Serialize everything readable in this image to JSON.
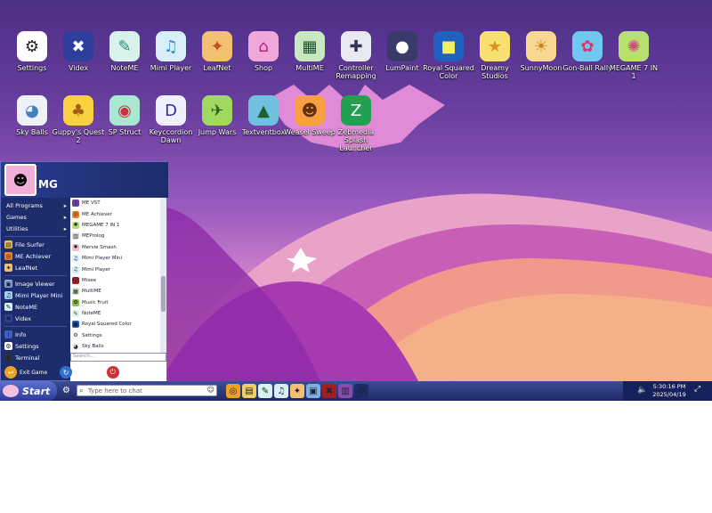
{
  "desktop_icons": [
    {
      "label": "Settings",
      "glyph": "⚙",
      "bg": "#ffffff",
      "fg": "#222222",
      "name": "settings"
    },
    {
      "label": "Videx",
      "glyph": "✖",
      "bg": "#2d3f9a",
      "fg": "#ffffff",
      "name": "videx"
    },
    {
      "label": "NoteME",
      "glyph": "✎",
      "bg": "#d9f2ec",
      "fg": "#2a8a70",
      "name": "noteme"
    },
    {
      "label": "Mimi Player",
      "glyph": "♫",
      "bg": "#d8eef8",
      "fg": "#3a8ac0",
      "name": "mimi-player"
    },
    {
      "label": "LeafNet",
      "glyph": "✦",
      "bg": "#f2c070",
      "fg": "#c05020",
      "name": "leafnet"
    },
    {
      "label": "Shop",
      "glyph": "⌂",
      "bg": "#f0a8d8",
      "fg": "#b02080",
      "name": "shop"
    },
    {
      "label": "MultiME",
      "glyph": "▦",
      "bg": "#c8e8c0",
      "fg": "#205030",
      "name": "multime"
    },
    {
      "label": "Controller Remapping",
      "glyph": "✚",
      "bg": "#e8e8f0",
      "fg": "#333355",
      "name": "controller-remapping"
    },
    {
      "label": "LumPaint",
      "glyph": "●",
      "bg": "#3a3a6a",
      "fg": "#ffffff",
      "name": "lumpaint"
    },
    {
      "label": "Royal Squared Color",
      "glyph": "■",
      "bg": "#2060c0",
      "fg": "#f0f060",
      "name": "royal-squared-color"
    },
    {
      "label": "Dreamy Studios",
      "glyph": "★",
      "bg": "#f8e070",
      "fg": "#e09020",
      "name": "dreamy-studios"
    },
    {
      "label": "SunnyMoon",
      "glyph": "☀",
      "bg": "#f8d890",
      "fg": "#d08020",
      "name": "sunnymoon"
    },
    {
      "label": "Gon-Ball Rally",
      "glyph": "✿",
      "bg": "#70c8f0",
      "fg": "#e03070",
      "name": "gon-ball-rally"
    },
    {
      "label": "MEGAME 7 IN 1",
      "glyph": "✺",
      "bg": "#b8e070",
      "fg": "#e04090",
      "name": "megame-7-in-1"
    },
    {
      "label": "Sky Balls",
      "glyph": "◕",
      "bg": "#f0f0f8",
      "fg": "#4080c0",
      "name": "sky-balls"
    },
    {
      "label": "Guppy's Quest 2",
      "glyph": "♣",
      "bg": "#f8d040",
      "fg": "#a06010",
      "name": "guppys-quest-2"
    },
    {
      "label": "SP Struct",
      "glyph": "◉",
      "bg": "#a8e8d0",
      "fg": "#d03040",
      "name": "sp-struct"
    },
    {
      "label": "Keyccordion Dawn",
      "glyph": "D",
      "bg": "#f0f0ff",
      "fg": "#3030a0",
      "name": "keyccordion-dawn"
    },
    {
      "label": "Jump Wars",
      "glyph": "✈",
      "bg": "#a0d860",
      "fg": "#306020",
      "name": "jump-wars"
    },
    {
      "label": "Textventbox",
      "glyph": "▲",
      "bg": "#70c0e0",
      "fg": "#206030",
      "name": "textventbox"
    },
    {
      "label": "Weasel Sweep",
      "glyph": "☻",
      "bg": "#f8a040",
      "fg": "#603010",
      "name": "weasel-sweep"
    },
    {
      "label": "Zebmedia Splash Launcher",
      "glyph": "Z",
      "bg": "#20a050",
      "fg": "#ffffff",
      "name": "zebmedia-splash-launcher"
    }
  ],
  "start_menu": {
    "user": "MG",
    "categories": [
      {
        "label": "All Programs",
        "arrow": "▸"
      },
      {
        "label": "Games",
        "arrow": "▸"
      },
      {
        "label": "Utilities",
        "arrow": "▸"
      }
    ],
    "pinned_a": [
      {
        "label": "File Surfer",
        "glyph": "▤",
        "color": "#f0c040"
      },
      {
        "label": "ME Achiever",
        "glyph": "◎",
        "color": "#f08020"
      },
      {
        "label": "LeafNet",
        "glyph": "✦",
        "color": "#f2c070"
      }
    ],
    "pinned_b": [
      {
        "label": "Image Viewer",
        "glyph": "▣",
        "color": "#80b0e0"
      },
      {
        "label": "Mimi Player Mini",
        "glyph": "♫",
        "color": "#a0d0f0"
      },
      {
        "label": "NoteME",
        "glyph": "✎",
        "color": "#d9f2ec"
      },
      {
        "label": "Videx",
        "glyph": "✖",
        "color": "#2d3f9a"
      }
    ],
    "pinned_c": [
      {
        "label": "Info",
        "glyph": "i",
        "color": "#4060c0"
      },
      {
        "label": "Settings",
        "glyph": "⚙",
        "color": "#ffffff"
      },
      {
        "label": "Terminal",
        "glyph": "▮",
        "color": "#303030"
      }
    ],
    "programs": [
      {
        "label": "ME VST",
        "glyph": "♪",
        "color": "#6a40a0"
      },
      {
        "label": "ME Achiever",
        "glyph": "◎",
        "color": "#f08020"
      },
      {
        "label": "MEGAME 7 IN 1",
        "glyph": "✺",
        "color": "#b8e070"
      },
      {
        "label": "MEProlog",
        "glyph": "▥",
        "color": "#e0e0e0"
      },
      {
        "label": "Mervie Smash",
        "glyph": "✹",
        "color": "#f0c0c0"
      },
      {
        "label": "Mimi Player Mini",
        "glyph": "♫",
        "color": "#d8eef8"
      },
      {
        "label": "Mimi Player",
        "glyph": "♫",
        "color": "#d8eef8"
      },
      {
        "label": "Mixee",
        "glyph": "☺",
        "color": "#a02020"
      },
      {
        "label": "MultiME",
        "glyph": "▦",
        "color": "#c8e8c0"
      },
      {
        "label": "Music Fruit",
        "glyph": "✿",
        "color": "#90c040"
      },
      {
        "label": "NoteME",
        "glyph": "✎",
        "color": "#d9f2ec"
      },
      {
        "label": "Royal Squared Color",
        "glyph": "■",
        "color": "#2060c0"
      },
      {
        "label": "Settings",
        "glyph": "⚙",
        "color": "#ffffff"
      },
      {
        "label": "Sky Balls",
        "glyph": "◕",
        "color": "#f0f0f8"
      }
    ],
    "search_placeholder": "Search...",
    "footer": {
      "exit": "Exit Game",
      "restart": "Restart",
      "shutdown": "Shut Down"
    }
  },
  "taskbar": {
    "start_label": "Start",
    "chat_placeholder": "Type here to chat",
    "apps": [
      {
        "glyph": "◎",
        "color": "#f0a020",
        "name": "me-achiever"
      },
      {
        "glyph": "▤",
        "color": "#f0d060",
        "name": "file-surfer"
      },
      {
        "glyph": "✎",
        "color": "#d9f2ec",
        "name": "noteme"
      },
      {
        "glyph": "♫",
        "color": "#d8eef8",
        "name": "mimi-player"
      },
      {
        "glyph": "✦",
        "color": "#f2c070",
        "name": "leafnet"
      },
      {
        "glyph": "▣",
        "color": "#80b0e0",
        "name": "image-viewer"
      },
      {
        "glyph": "✖",
        "color": "#a02020",
        "name": "mixee"
      },
      {
        "glyph": "▥",
        "color": "#8a4ab0",
        "name": "wallpaper"
      },
      {
        "glyph": "⚙",
        "color": "#1e2a66",
        "name": "settings"
      }
    ],
    "time": "5:30:16 PM",
    "date": "2025/04/19"
  }
}
